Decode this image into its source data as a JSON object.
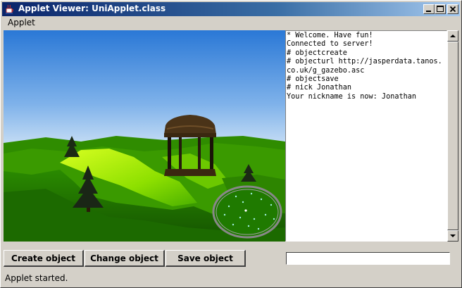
{
  "window": {
    "title": "Applet Viewer: UniApplet.class"
  },
  "menu": {
    "items": [
      {
        "label": "Applet"
      }
    ]
  },
  "chat": {
    "lines": [
      "* Welcome. Have fun!",
      "Connected to server!",
      "# objectcreate",
      "# objecturl http://jasperdata.tanos.co.uk/g_gazebo.asc",
      "# objectsave",
      "# nick Jonathan",
      "Your nickname is now: Jonathan"
    ],
    "input_value": ""
  },
  "buttons": {
    "create": "Create object",
    "change": "Change object",
    "save": "Save object"
  },
  "status": {
    "text": "Applet started."
  },
  "colors": {
    "sky_top": "#2f7fd8",
    "sky_bottom": "#c5dcf5",
    "grass_dark": "#1e6b00",
    "grass_light": "#b8f000",
    "titlebar": "#0a246a",
    "chrome": "#d4d0c8",
    "minimap_dot": "#9ff0e0"
  },
  "icons": {
    "app": "java-cup-icon",
    "minimize": "minimize-icon",
    "maximize": "maximize-icon",
    "close": "close-icon",
    "scroll_up": "arrow-up-icon",
    "scroll_down": "arrow-down-icon"
  }
}
